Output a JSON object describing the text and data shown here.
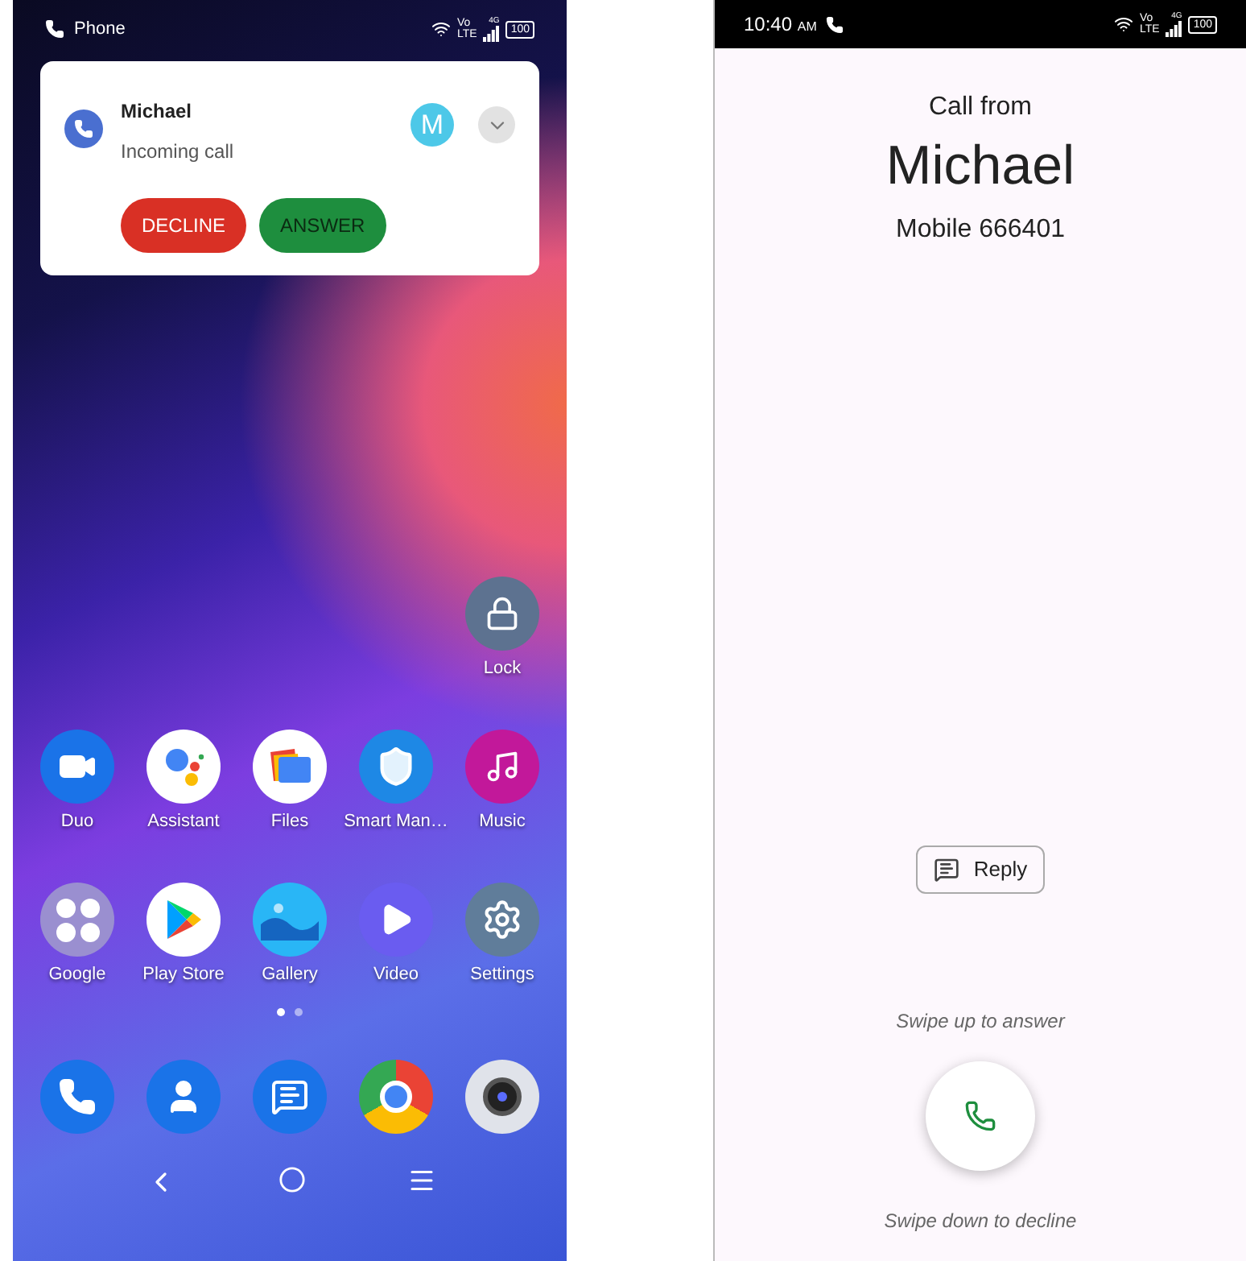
{
  "home_screen": {
    "status_bar": {
      "app_label": "Phone",
      "volte_top": "Vo",
      "volte_bottom": "LTE",
      "network_type": "4G",
      "battery": "100"
    },
    "notification": {
      "caller": "Michael",
      "subtitle": "Incoming call",
      "avatar_letter": "M",
      "buttons": [
        {
          "label": "DECLINE",
          "kind": "decline"
        },
        {
          "label": "ANSWER",
          "kind": "answer"
        }
      ]
    },
    "shortcut": {
      "label": "Lock",
      "kind": "lock"
    },
    "app_rows": [
      [
        {
          "label": "Duo",
          "kind": "duo"
        },
        {
          "label": "Assistant",
          "kind": "assistant"
        },
        {
          "label": "Files",
          "kind": "files"
        },
        {
          "label": "Smart Man…",
          "kind": "shield"
        },
        {
          "label": "Music",
          "kind": "music"
        }
      ],
      [
        {
          "label": "Google",
          "kind": "google_folder"
        },
        {
          "label": "Play Store",
          "kind": "play_store"
        },
        {
          "label": "Gallery",
          "kind": "gallery"
        },
        {
          "label": "Video",
          "kind": "video"
        },
        {
          "label": "Settings",
          "kind": "settings"
        }
      ]
    ],
    "page_dots": [
      {
        "selected": true
      },
      {
        "selected": false
      }
    ],
    "dock": [
      {
        "kind": "phone"
      },
      {
        "kind": "contacts"
      },
      {
        "kind": "messages"
      },
      {
        "kind": "chrome"
      },
      {
        "kind": "camera"
      }
    ]
  },
  "call_screen": {
    "status_bar": {
      "time": "10:40",
      "meridiem": "AM",
      "volte_top": "Vo",
      "volte_bottom": "LTE",
      "network_type": "4G",
      "battery": "100"
    },
    "header": "Call from",
    "caller": "Michael",
    "number": "Mobile 666401",
    "reply_button": "Reply",
    "answer_hint": "Swipe up to answer",
    "decline_hint": "Swipe down to decline"
  }
}
